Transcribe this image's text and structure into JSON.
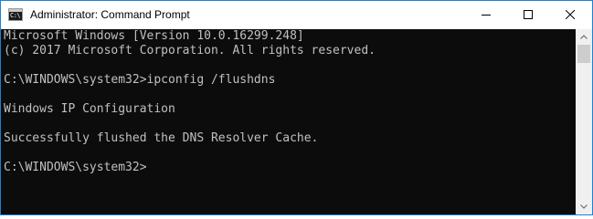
{
  "window": {
    "title": "Administrator: Command Prompt",
    "app_icon": "cmd-icon",
    "app_icon_text": "C:\\",
    "buttons": {
      "minimize": "minimize-icon",
      "maximize": "maximize-icon",
      "close": "close-icon"
    }
  },
  "console": {
    "background": "#0c0c0c",
    "foreground": "#c0c0c0",
    "lines": [
      "Microsoft Windows [Version 10.0.16299.248]",
      "(c) 2017 Microsoft Corporation. All rights reserved.",
      "",
      "C:\\WINDOWS\\system32>ipconfig /flushdns",
      "",
      "Windows IP Configuration",
      "",
      "Successfully flushed the DNS Resolver Cache.",
      "",
      "C:\\WINDOWS\\system32>"
    ]
  },
  "scrollbar": {
    "up_arrow": "scroll-up-icon",
    "down_arrow": "scroll-down-icon"
  }
}
